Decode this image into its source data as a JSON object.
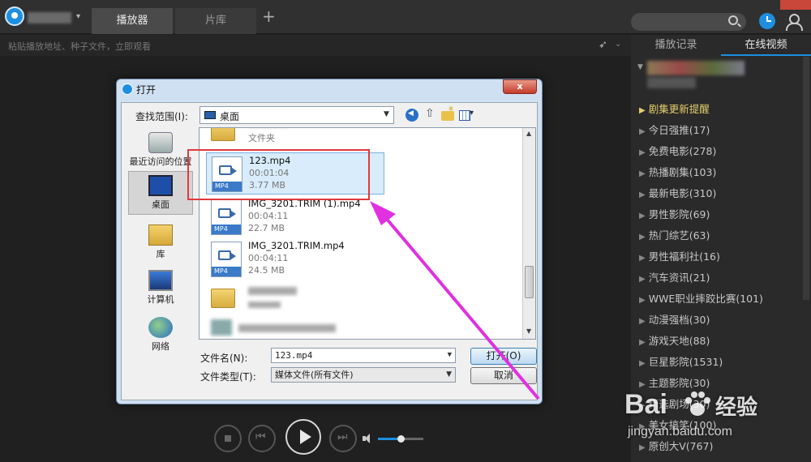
{
  "header": {
    "tabs": [
      {
        "label": "播放器"
      },
      {
        "label": "片库"
      }
    ],
    "add_tab": "+"
  },
  "addressbar": {
    "placeholder": "粘贴播放地址、种子文件，立即观看"
  },
  "right_panel": {
    "tabs": [
      {
        "label": "播放记录"
      },
      {
        "label": "在线视频"
      }
    ],
    "categories": [
      {
        "label": "剧集更新提醒",
        "highlight": true
      },
      {
        "label": "今日强推(17)"
      },
      {
        "label": "免费电影(278)"
      },
      {
        "label": "热播剧集(103)"
      },
      {
        "label": "最新电影(310)"
      },
      {
        "label": "男性影院(69)"
      },
      {
        "label": "热门综艺(63)"
      },
      {
        "label": "男性福利社(16)"
      },
      {
        "label": "汽车资讯(21)"
      },
      {
        "label": "WWE职业摔跤比赛(101)"
      },
      {
        "label": "动漫强档(30)"
      },
      {
        "label": "游戏天地(88)"
      },
      {
        "label": "巨星影院(1531)"
      },
      {
        "label": "主题影院(30)"
      },
      {
        "label": "精选剧场(30)"
      },
      {
        "label": "美女搞笑(100)"
      },
      {
        "label": "原创大V(767)"
      }
    ]
  },
  "player": {
    "volume": 0.5
  },
  "dialog": {
    "title": "打开",
    "close_label": "x",
    "look_in_label": "查找范围(I):",
    "look_in_value": "桌面",
    "places": [
      {
        "label": "最近访问的位置"
      },
      {
        "label": "桌面"
      },
      {
        "label": "库"
      },
      {
        "label": "计算机"
      },
      {
        "label": "网络"
      }
    ],
    "folder_top": {
      "type": "文件夹"
    },
    "files": [
      {
        "name": "123.mp4",
        "duration": "00:01:04",
        "size": "3.77 MB",
        "tag": "MP4"
      },
      {
        "name": "IMG_3201.TRIM (1).mp4",
        "duration": "00:04:11",
        "size": "22.7 MB",
        "tag": "MP4"
      },
      {
        "name": "IMG_3201.TRIM.mp4",
        "duration": "00:04:11",
        "size": "24.5 MB",
        "tag": "MP4"
      }
    ],
    "filename_label": "文件名(N):",
    "filename_value": "123.mp4",
    "filetype_label": "文件类型(T):",
    "filetype_value": "媒体文件(所有文件)",
    "open_button": "打开(O)",
    "cancel_button": "取消"
  },
  "watermark": {
    "logo": "Bai",
    "logo_cn": "经验",
    "url": "jingyan.baidu.com"
  },
  "colors": {
    "accent": "#1e8fe0",
    "highlight_text": "#e4cf6a",
    "annotation_red": "#e03a3a",
    "annotation_arrow": "#e030e0"
  }
}
